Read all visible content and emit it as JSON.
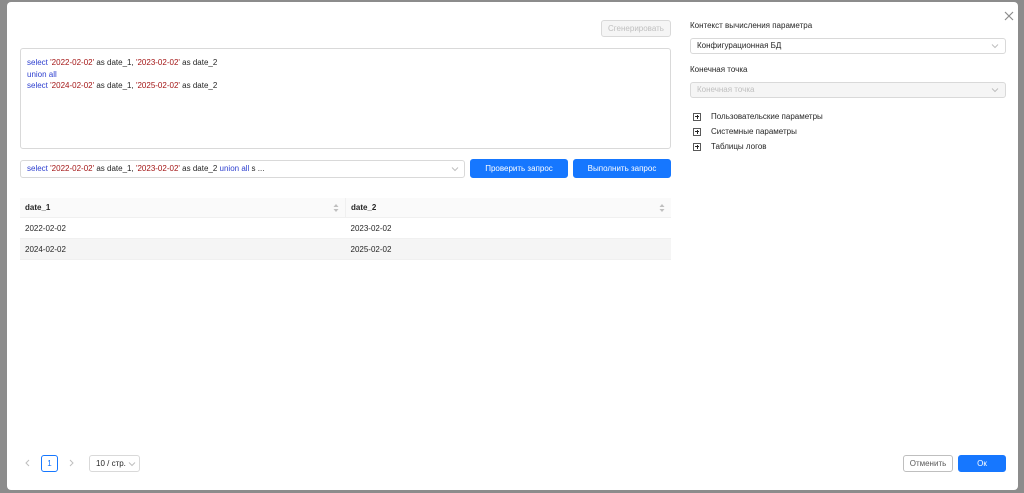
{
  "dialog": {
    "generate_label": "Сгенерировать",
    "cancel_label": "Отменить",
    "ok_label": "Ок"
  },
  "editor": {
    "lines": [
      [
        {
          "t": "select",
          "c": "kw"
        },
        {
          "t": " ",
          "c": "plain"
        },
        {
          "t": "'2022-02-02'",
          "c": "str"
        },
        {
          "t": " as date_1, ",
          "c": "plain"
        },
        {
          "t": "'2023-02-02'",
          "c": "str"
        },
        {
          "t": " as date_2",
          "c": "plain"
        }
      ],
      [
        {
          "t": "union all",
          "c": "kw"
        }
      ],
      [
        {
          "t": "select",
          "c": "kw"
        },
        {
          "t": " ",
          "c": "plain"
        },
        {
          "t": "'2024-02-02'",
          "c": "str"
        },
        {
          "t": " as date_1, ",
          "c": "plain"
        },
        {
          "t": "'2025-02-02'",
          "c": "str"
        },
        {
          "t": " as date_2",
          "c": "plain"
        }
      ]
    ]
  },
  "query_select": {
    "parts": [
      {
        "t": "select",
        "c": "kw"
      },
      {
        "t": " ",
        "c": "plain"
      },
      {
        "t": "'2022-02-02'",
        "c": "str"
      },
      {
        "t": " as date_1, ",
        "c": "plain"
      },
      {
        "t": "'2023-02-02'",
        "c": "str"
      },
      {
        "t": " as date_2 ",
        "c": "plain"
      },
      {
        "t": "union all",
        "c": "kw"
      },
      {
        "t": " s ...",
        "c": "plain"
      }
    ]
  },
  "actions": {
    "check_label": "Проверить запрос",
    "run_label": "Выполнить запрос"
  },
  "table": {
    "columns": [
      "date_1",
      "date_2"
    ],
    "rows": [
      [
        "2022-02-02",
        "2023-02-02"
      ],
      [
        "2024-02-02",
        "2025-02-02"
      ]
    ]
  },
  "context": {
    "label": "Контекст вычисления параметра",
    "value": "Конфигурационная БД"
  },
  "endpoint": {
    "label": "Конечная точка",
    "placeholder": "Конечная точка"
  },
  "tree": {
    "items": [
      {
        "label": "Пользовательские параметры"
      },
      {
        "label": "Системные параметры"
      },
      {
        "label": "Таблицы логов"
      }
    ]
  },
  "pagination": {
    "current_page": "1",
    "page_size": "10 / стр."
  },
  "colors": {
    "primary": "#1677ff",
    "keyword": "#2d3fcf",
    "string": "#a31515"
  },
  "icons": {
    "close": "close-icon",
    "chevron": "chevron-down-icon",
    "sort": "sort-icon",
    "expand": "plus-square-icon",
    "prev": "chevron-left-icon",
    "next": "chevron-right-icon"
  }
}
